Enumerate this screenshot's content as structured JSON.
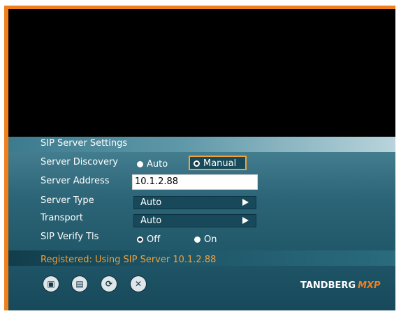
{
  "title": "SIP Server Settings",
  "rows": {
    "server_discovery": {
      "label": "Server Discovery",
      "options": [
        "Auto",
        "Manual"
      ],
      "selected": "Manual"
    },
    "server_address": {
      "label": "Server Address",
      "value": "10.1.2.88"
    },
    "server_type": {
      "label": "Server Type",
      "value": "Auto"
    },
    "transport": {
      "label": "Transport",
      "value": "Auto"
    },
    "sip_verify_tls": {
      "label": "SIP Verify Tls",
      "options": [
        "Off",
        "On"
      ],
      "selected": "Off"
    }
  },
  "status_text": "Registered: Using SIP Server 10.1.2.88",
  "brand": {
    "name": "TANDBERG",
    "suffix": "MXP"
  },
  "buttons": [
    "save-icon",
    "save-as-icon",
    "refresh-icon",
    "close-icon"
  ],
  "colors": {
    "border": "#f07f1e",
    "status": "#f0a03d",
    "panel": "#1f5668"
  }
}
